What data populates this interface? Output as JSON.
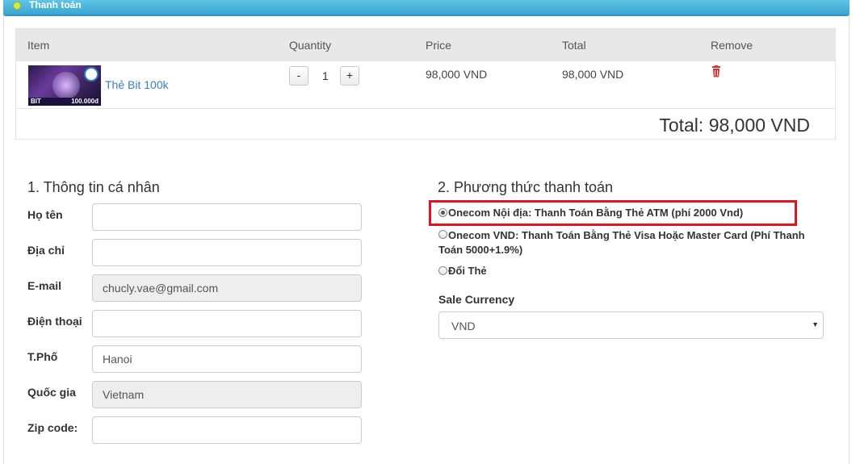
{
  "header": {
    "title": "Thanh toán"
  },
  "cart": {
    "columns": {
      "item": "Item",
      "quantity": "Quantity",
      "price": "Price",
      "total": "Total",
      "remove": "Remove"
    },
    "items": [
      {
        "thumb_left": "BIT",
        "thumb_right": "100.000đ",
        "name": "Thẻ Bit 100k",
        "minus": "-",
        "quantity": "1",
        "plus": "+",
        "price": "98,000 VND",
        "total": "98,000 VND",
        "remove_icon": "trash-icon"
      }
    ],
    "grand_total": "Total: 98,000 VND"
  },
  "personal": {
    "title": "1. Thông tin cá nhân",
    "fields": [
      {
        "label": "Họ tên",
        "value": ""
      },
      {
        "label": "Địa chỉ",
        "value": ""
      },
      {
        "label": "E-mail",
        "value": "chucly.vae@gmail.com"
      },
      {
        "label": "Điện thoại",
        "value": ""
      },
      {
        "label": "T.Phố",
        "value": "Hanoi"
      },
      {
        "label": "Quốc gia",
        "value": "Vietnam"
      },
      {
        "label": "Zip code:",
        "value": ""
      }
    ]
  },
  "payment": {
    "title": "2. Phương thức thanh toán",
    "options": [
      {
        "label": "Onecom Nội địa: Thanh Toán Bằng Thẻ ATM (phí 2000 Vnd)",
        "selected": true
      },
      {
        "label_line1": "Onecom VND: Thanh Toán Bằng Thẻ Visa Hoặc Master Card (Phí Thanh",
        "label_line2": "Toán 5000+1.9%)",
        "selected": false
      },
      {
        "label": "Đổi Thẻ",
        "selected": false
      }
    ],
    "currency_label": "Sale Currency",
    "currency_value": "VND"
  },
  "colors": {
    "header": "#3aa6d0",
    "link": "#3a7fc0",
    "highlight": "#e0141e",
    "trash": "#d9342b"
  }
}
